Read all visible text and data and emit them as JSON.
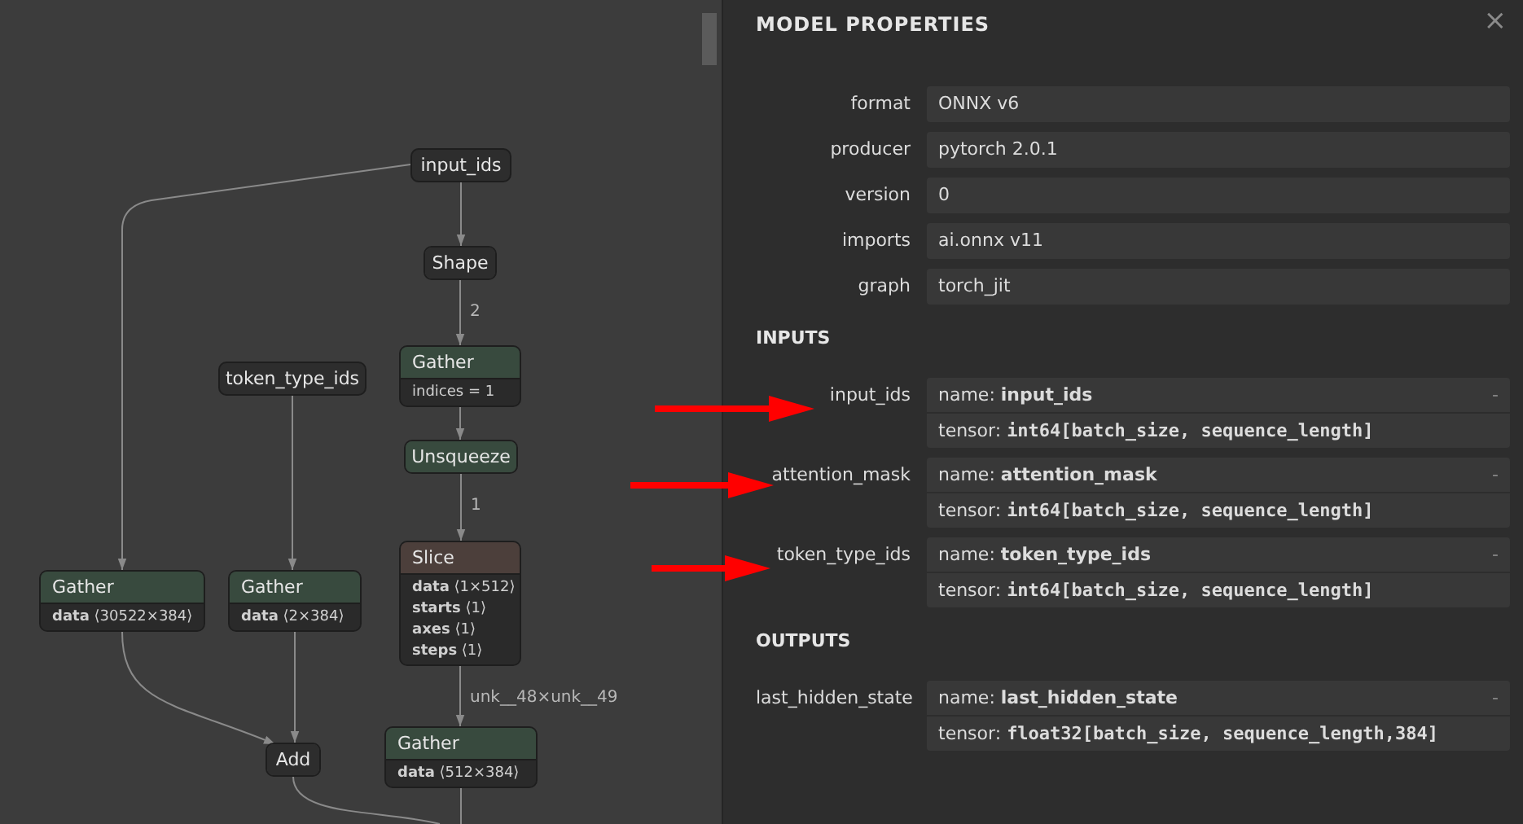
{
  "graph": {
    "nodes": [
      {
        "kind": "input",
        "title": "input_ids"
      },
      {
        "kind": "op",
        "title": "Shape",
        "color": "#2d2d2d",
        "output_label": "2"
      },
      {
        "kind": "input",
        "title": "token_type_ids"
      },
      {
        "kind": "op",
        "title": "Gather",
        "color": "#384a3e",
        "attributes": [
          "indices = 1"
        ]
      },
      {
        "kind": "op",
        "title": "Unsqueeze",
        "color": "#384a3e",
        "output_label": "1"
      },
      {
        "kind": "op",
        "title": "Gather",
        "color": "#384a3e",
        "attributes": [
          "**data** ⟨30522×384⟩"
        ]
      },
      {
        "kind": "op",
        "title": "Gather",
        "color": "#384a3e",
        "attributes": [
          "**data** ⟨2×384⟩"
        ]
      },
      {
        "kind": "op",
        "title": "Slice",
        "color": "#4c3f3b",
        "attributes": [
          "**data** ⟨1×512⟩",
          "**starts** ⟨1⟩",
          "**axes** ⟨1⟩",
          "**steps** ⟨1⟩"
        ],
        "output_label": "unk__48×unk__49"
      },
      {
        "kind": "op",
        "title": "Add",
        "color": "#2d2d2d"
      },
      {
        "kind": "op",
        "title": "Gather",
        "color": "#384a3e",
        "attributes": [
          "**data** ⟨512×384⟩"
        ]
      }
    ]
  },
  "properties": {
    "title": "MODEL PROPERTIES",
    "close": "×",
    "fields": [
      {
        "label": "format",
        "value": "ONNX v6"
      },
      {
        "label": "producer",
        "value": "pytorch 2.0.1"
      },
      {
        "label": "version",
        "value": "0"
      },
      {
        "label": "imports",
        "value": "ai.onnx v11"
      },
      {
        "label": "graph",
        "value": "torch_jit"
      }
    ],
    "sections": [
      {
        "heading": "INPUTS",
        "arguments": [
          {
            "label": "input_ids",
            "name_prefix": "name:",
            "name": "input_ids",
            "type_prefix": "tensor:",
            "type": "int64[batch_size, sequence_length]",
            "toggle": "-",
            "annotated": true
          },
          {
            "label": "attention_mask",
            "name_prefix": "name:",
            "name": "attention_mask",
            "type_prefix": "tensor:",
            "type": "int64[batch_size, sequence_length]",
            "toggle": "-",
            "annotated": true
          },
          {
            "label": "token_type_ids",
            "name_prefix": "name:",
            "name": "token_type_ids",
            "type_prefix": "tensor:",
            "type": "int64[batch_size, sequence_length]",
            "toggle": "-",
            "annotated": true
          }
        ]
      },
      {
        "heading": "OUTPUTS",
        "arguments": [
          {
            "label": "last_hidden_state",
            "name_prefix": "name:",
            "name": "last_hidden_state",
            "type_prefix": "tensor:",
            "type": "float32[batch_size, sequence_length,384]",
            "toggle": "-",
            "annotated": false
          }
        ]
      }
    ]
  }
}
